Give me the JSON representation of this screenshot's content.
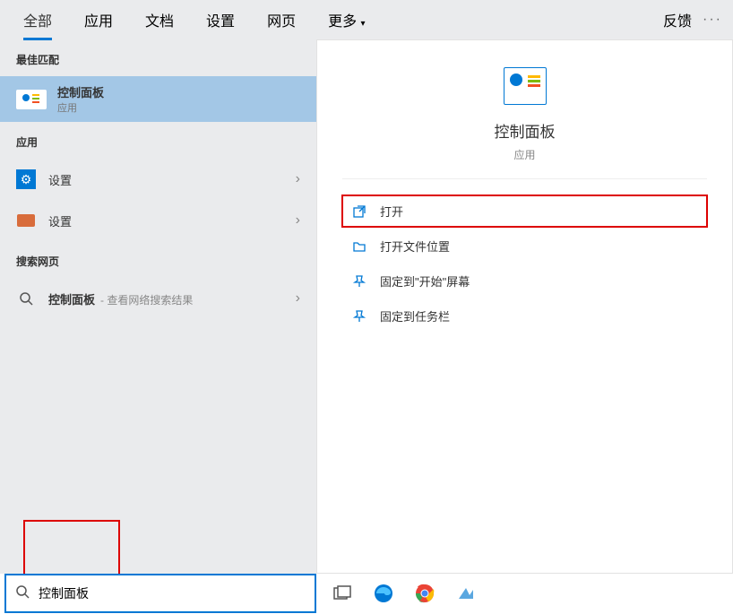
{
  "tabs": {
    "all": "全部",
    "apps": "应用",
    "docs": "文档",
    "settings": "设置",
    "web": "网页",
    "more": "更多",
    "feedback": "反馈"
  },
  "sections": {
    "best_match": "最佳匹配",
    "apps": "应用",
    "search_web": "搜索网页"
  },
  "best_match_item": {
    "title": "控制面板",
    "subtitle": "应用"
  },
  "app_items": {
    "settings1": "设置",
    "settings2": "设置"
  },
  "web_item": {
    "prefix": "控制面板",
    "suffix": "- 查看网络搜索结果"
  },
  "preview": {
    "title": "控制面板",
    "subtitle": "应用"
  },
  "actions": {
    "open": "打开",
    "open_location": "打开文件位置",
    "pin_start": "固定到\"开始\"屏幕",
    "pin_taskbar": "固定到任务栏"
  },
  "search": {
    "value": "控制面板"
  }
}
